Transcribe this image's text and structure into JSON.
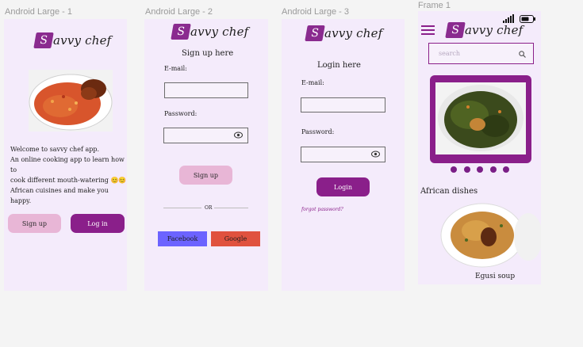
{
  "frames": {
    "f1_title": "Android Large - 1",
    "f2_title": "Android Large - 2",
    "f3_title": "Android Large - 3",
    "f4_title": "Frame 1"
  },
  "brand": {
    "mark": "S",
    "name": "avvy chef",
    "accent": "#8a1f8a",
    "pink": "#e8b6d6",
    "bg": "#f4ebfb"
  },
  "screen1": {
    "welcome_line1": "Welcome to savvy chef app.",
    "welcome_line2": "An online cooking app to learn how to",
    "welcome_line3": "cook different mouth-watering 😊😊",
    "welcome_line4": "African cuisines and make you happy.",
    "signup_label": "Sign up",
    "login_label": "Log in"
  },
  "screen2": {
    "heading": "Sign up here",
    "email_label": "E-mail:",
    "password_label": "Password:",
    "signup_label": "Sign up",
    "or_label": "OR",
    "facebook_label": "Facebook",
    "google_label": "Google",
    "facebook_color": "#6c63ff",
    "google_color": "#e0523e"
  },
  "screen3": {
    "heading": "Login here",
    "email_label": "E-mail:",
    "password_label": "Password:",
    "login_label": "Login",
    "forgot_label": "forgot password?"
  },
  "screen4": {
    "search_placeholder": "search",
    "section_title": "African dishes",
    "dish_name": "Egusi soup",
    "carousel_dots": 5
  },
  "icons": {
    "menu": "hamburger-icon",
    "search": "search-icon",
    "eye": "eye-icon",
    "signal": "signal-icon",
    "battery": "battery-icon"
  }
}
